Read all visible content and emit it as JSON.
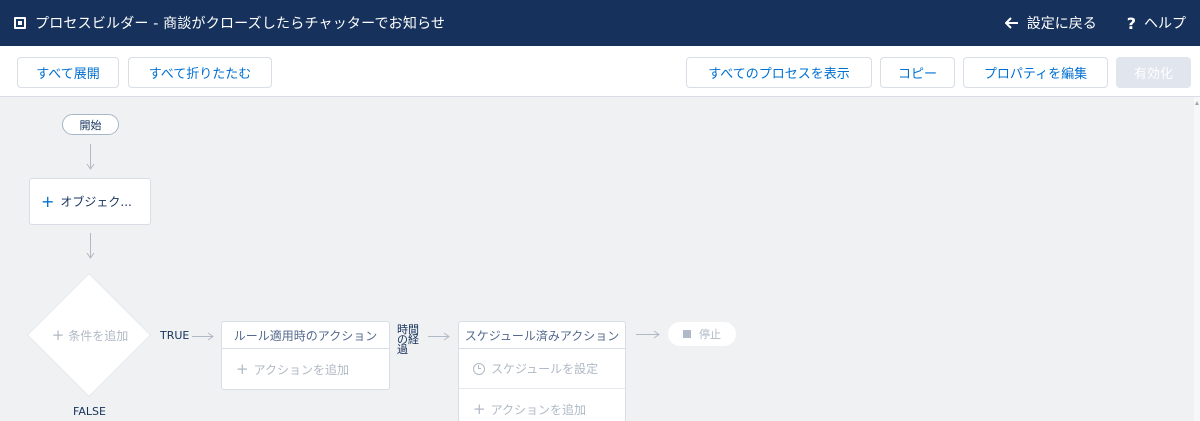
{
  "header": {
    "title": "プロセスビルダー - 商談がクローズしたらチャッターでお知らせ",
    "back_label": "設定に戻る",
    "help_label": "ヘルプ",
    "help_mark": "?",
    "bg_color": "#16325c"
  },
  "toolbar": {
    "expand_all": "すべて展開",
    "collapse_all": "すべて折りたたむ",
    "view_all_processes": "すべてのプロセスを表示",
    "copy": "コピー",
    "edit_properties": "プロパティを編集",
    "activate": "有効化"
  },
  "canvas": {
    "start_label": "開始",
    "object_label": "オブジェク...",
    "condition_label": "条件を追加",
    "true_label": "TRUE",
    "false_label": "FALSE",
    "immediate_actions": {
      "header": "ルール適用時のアクション",
      "add_action": "アクションを追加"
    },
    "time_elapsed_label": [
      "時間",
      "の経",
      "過"
    ],
    "scheduled_actions": {
      "header": "スケジュール済みアクション",
      "set_schedule": "スケジュールを設定",
      "add_action": "アクションを追加"
    },
    "stop_label": "停止"
  },
  "colors": {
    "accent": "#0070d2",
    "canvas_bg": "#f0f1f2",
    "disabled_text": "#b0b9c5"
  }
}
